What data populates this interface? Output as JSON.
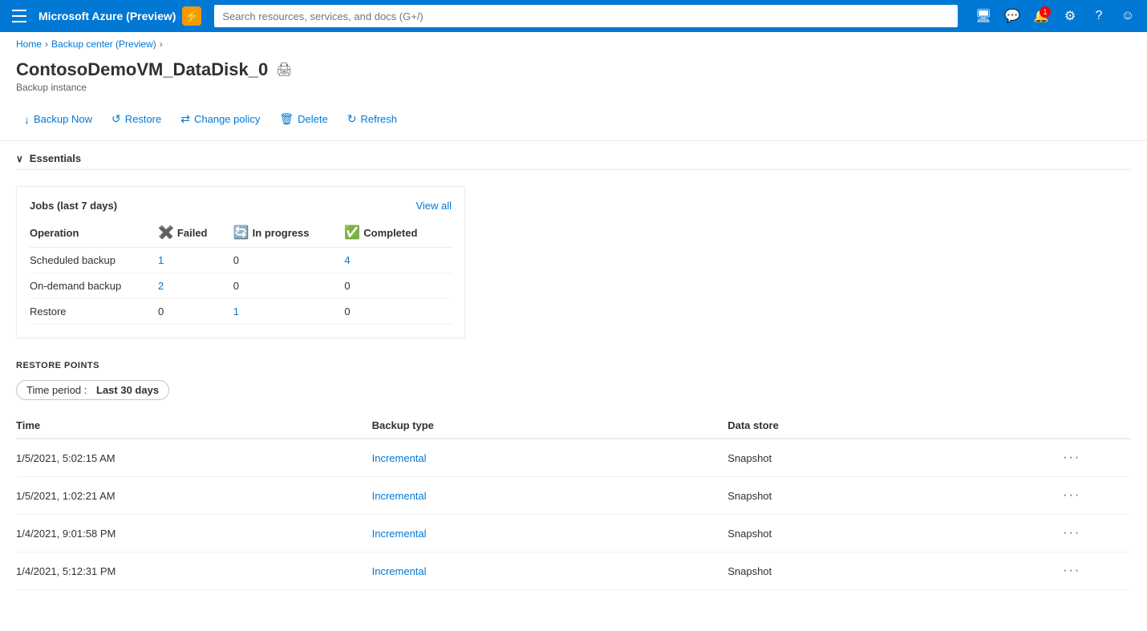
{
  "topbar": {
    "title": "Microsoft Azure (Preview)",
    "search_placeholder": "Search resources, services, and docs (G+/)",
    "notification_count": "1"
  },
  "breadcrumb": {
    "home": "Home",
    "parent": "Backup center (Preview)"
  },
  "page": {
    "title": "ContosoDemoVM_DataDisk_0",
    "subtitle": "Backup instance"
  },
  "toolbar": {
    "backup_now": "Backup Now",
    "restore": "Restore",
    "change_policy": "Change policy",
    "delete": "Delete",
    "refresh": "Refresh"
  },
  "essentials": {
    "label": "Essentials"
  },
  "jobs_card": {
    "title": "Jobs (last 7 days)",
    "view_all": "View all",
    "columns": {
      "operation": "Operation",
      "failed": "Failed",
      "in_progress": "In progress",
      "completed": "Completed"
    },
    "rows": [
      {
        "operation": "Scheduled backup",
        "failed": "1",
        "failed_link": true,
        "in_progress": "0",
        "in_progress_link": false,
        "completed": "4",
        "completed_link": true
      },
      {
        "operation": "On-demand backup",
        "failed": "2",
        "failed_link": true,
        "in_progress": "0",
        "in_progress_link": false,
        "completed": "0",
        "completed_link": false
      },
      {
        "operation": "Restore",
        "failed": "0",
        "failed_link": false,
        "in_progress": "1",
        "in_progress_link": true,
        "completed": "0",
        "completed_link": false
      }
    ]
  },
  "restore_points": {
    "title": "RESTORE POINTS",
    "filter_label": "Time period :",
    "filter_value": "Last 30 days",
    "columns": {
      "time": "Time",
      "backup_type": "Backup type",
      "data_store": "Data store"
    },
    "rows": [
      {
        "time": "1/5/2021, 5:02:15 AM",
        "backup_type": "Incremental",
        "data_store": "Snapshot"
      },
      {
        "time": "1/5/2021, 1:02:21 AM",
        "backup_type": "Incremental",
        "data_store": "Snapshot"
      },
      {
        "time": "1/4/2021, 9:01:58 PM",
        "backup_type": "Incremental",
        "data_store": "Snapshot"
      },
      {
        "time": "1/4/2021, 5:12:31 PM",
        "backup_type": "Incremental",
        "data_store": "Snapshot"
      }
    ]
  }
}
